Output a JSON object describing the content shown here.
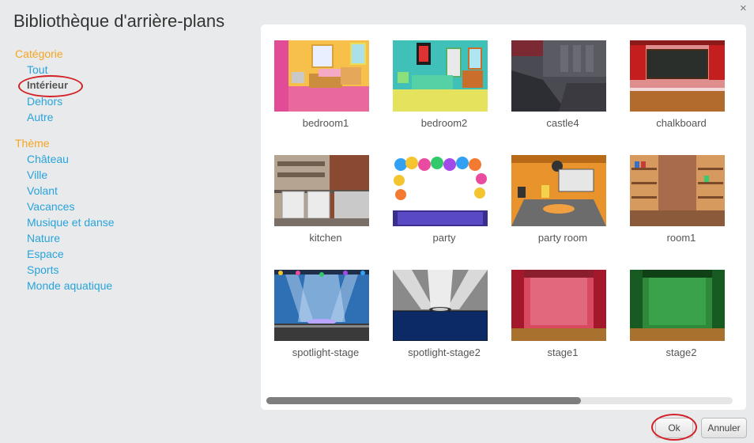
{
  "dialog": {
    "title": "Bibliothèque d'arrière-plans",
    "close_glyph": "×"
  },
  "sidebar": {
    "category_title": "Catégorie",
    "categories": [
      {
        "label": "Tout"
      },
      {
        "label": "Intérieur",
        "selected": true
      },
      {
        "label": "Dehors"
      },
      {
        "label": "Autre"
      }
    ],
    "theme_title": "Thème",
    "themes": [
      {
        "label": "Château"
      },
      {
        "label": "Ville"
      },
      {
        "label": "Volant"
      },
      {
        "label": "Vacances"
      },
      {
        "label": "Musique et danse"
      },
      {
        "label": "Nature"
      },
      {
        "label": "Espace"
      },
      {
        "label": "Sports"
      },
      {
        "label": "Monde aquatique"
      }
    ]
  },
  "backdrops": [
    {
      "name": "bedroom1"
    },
    {
      "name": "bedroom2"
    },
    {
      "name": "castle4"
    },
    {
      "name": "chalkboard"
    },
    {
      "name": "kitchen"
    },
    {
      "name": "party"
    },
    {
      "name": "party room"
    },
    {
      "name": "room1"
    },
    {
      "name": "spotlight-stage"
    },
    {
      "name": "spotlight-stage2"
    },
    {
      "name": "stage1"
    },
    {
      "name": "stage2"
    }
  ],
  "buttons": {
    "ok": "Ok",
    "cancel": "Annuler"
  },
  "colors": {
    "accent": "#29a3db",
    "section": "#f5a623",
    "highlight": "#d42027"
  }
}
